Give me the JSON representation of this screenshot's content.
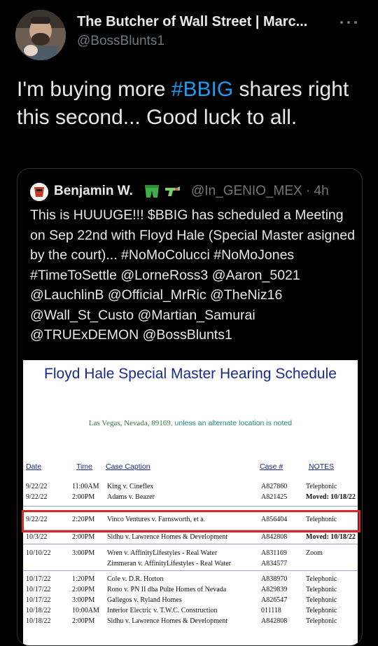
{
  "header": {
    "display_name": "The Butcher of Wall Street | Marc...",
    "handle": "@BossBlunts1"
  },
  "tweet": {
    "text_before": "I'm buying more ",
    "hashtag": "#BBIG",
    "text_after": " shares right this second... Good luck to all."
  },
  "quote": {
    "name": "Benjamin W.",
    "emojis": [
      "shorts-icon",
      "water-gun-icon"
    ],
    "handle": "@In_GENIO_MEX · 4h",
    "text": "This is HUUUGE!!! $BBIG has scheduled a Meeting on Sep 22nd with Floyd Hale (Special Master asigned by the court)... #NoMoColucci #NoMoJones #TimeToSettle @LorneRoss3 @Aaron_5021 @LauchlinB @Official_MrRic @TheNiz16 @Wall_St_Custo @Martian_Samurai @TRUExDEMON @BossBlunts1"
  },
  "document": {
    "title": "Floyd Hale Special Master Hearing Schedule",
    "location": "Las Vegas, Nevada, 89169",
    "location_note": ", unless an alternate location is noted",
    "headers": {
      "date": "Date",
      "time": "Time",
      "case": "Case Caption",
      "num": "Case #",
      "notes": "NOTES"
    },
    "rows": [
      {
        "date": "9/22/22",
        "time": "11:00AM",
        "case": "King v. Cineflex",
        "num": "A827860",
        "notes": "Telephonic",
        "bold": false
      },
      {
        "date": "9/22/22",
        "time": "2:00PM",
        "case": "Adams v. Beazer",
        "num": "A821425",
        "notes": "Moved: 10/18/22",
        "bold": true
      },
      {
        "date": "9/22/22",
        "time": "2:20PM",
        "case": "Vinco Ventures v. Farnsworth, et a.",
        "num": "A856404",
        "notes": "Telephonic",
        "bold": false
      },
      {
        "date": "10/3/22",
        "time": "2:00PM",
        "case": "Sidhu v. Lawrence Homes & Development",
        "num": "A842808",
        "notes": "Moved: 10/18/22",
        "bold": true
      },
      {
        "date": "10/10/22",
        "time": "3:00PM",
        "case": "Wren v. AffinityLifestyles - Real Water",
        "num": "A831169",
        "notes": "Zoom",
        "bold": false
      },
      {
        "date": "",
        "time": "",
        "case": "Zimmeran v. AffinityLifestyles - Real Water",
        "num": "A834577",
        "notes": "",
        "bold": false
      },
      {
        "date": "10/17/22",
        "time": "1:20PM",
        "case": "Cole v. D.R. Horton",
        "num": "A838970",
        "notes": "Telephonic",
        "bold": false
      },
      {
        "date": "10/17/22",
        "time": "2:00PM",
        "case": "Rono v. PN II dba Pulte Homes of Nevada",
        "num": "A829839",
        "notes": "Telephonic",
        "bold": false
      },
      {
        "date": "10/17/22",
        "time": "3:00PM",
        "case": "Gallegos v. Ryland Homes",
        "num": "A826547",
        "notes": "Telephonic",
        "bold": false
      },
      {
        "date": "10/18/22",
        "time": "10:00AM",
        "case": "Interior Electric v. T.W.C. Construction",
        "num": "011118",
        "notes": "Telephonic",
        "bold": false
      },
      {
        "date": "10/18/22",
        "time": "2:00PM",
        "case": "Sidhu v. Lawrence Homes & Development",
        "num": "A842808",
        "notes": "Telephonic",
        "bold": false
      }
    ]
  }
}
